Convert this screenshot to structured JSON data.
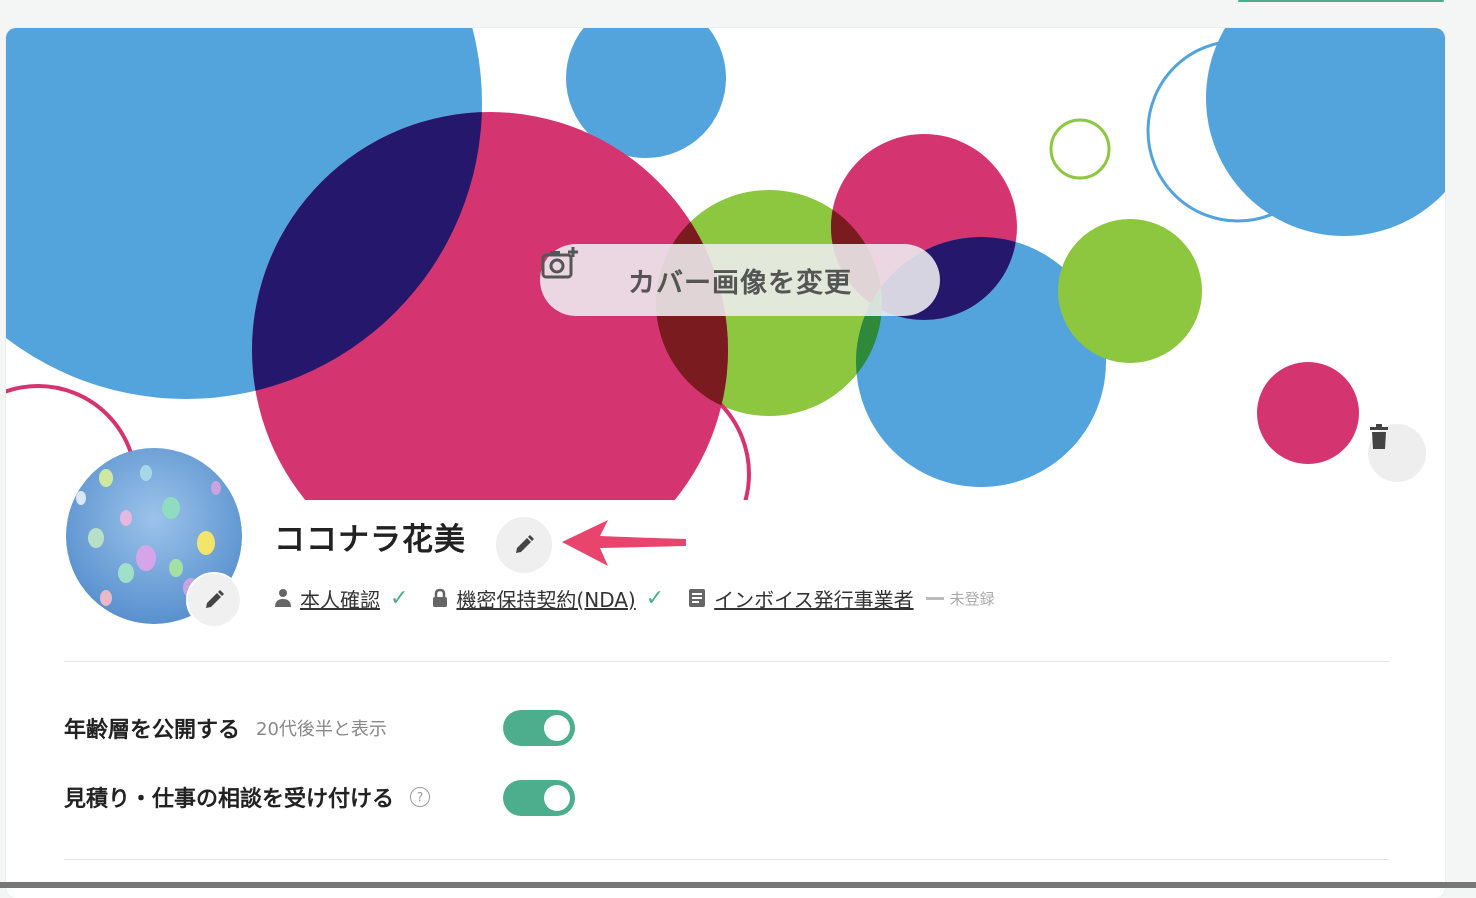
{
  "cover": {
    "change_label": "カバー画像を変更",
    "camera_icon": "camera-plus-icon",
    "delete_icon": "trash-icon"
  },
  "profile": {
    "name": "ココナラ花美",
    "edit_icon": "pencil-icon"
  },
  "status": {
    "identity": {
      "icon": "person-icon",
      "label": "本人確認",
      "verified": true
    },
    "nda": {
      "icon": "lock-icon",
      "label": "機密保持契約(NDA)",
      "verified": true
    },
    "invoice": {
      "icon": "document-icon",
      "label": "インボイス発行事業者",
      "state": "未登録"
    }
  },
  "settings": {
    "age": {
      "label": "年齢層を公開する",
      "note": "20代後半と表示",
      "enabled": true
    },
    "consult": {
      "label": "見積り・仕事の相談を受け付ける",
      "help_icon": "question-icon",
      "enabled": true
    }
  },
  "colors": {
    "accent_green": "#4cae8c",
    "annotation_arrow": "#e8446e",
    "cover_blue": "#53a4dc",
    "cover_pink": "#d43571",
    "cover_lime": "#8dc63f",
    "cover_navy": "#25186c"
  }
}
